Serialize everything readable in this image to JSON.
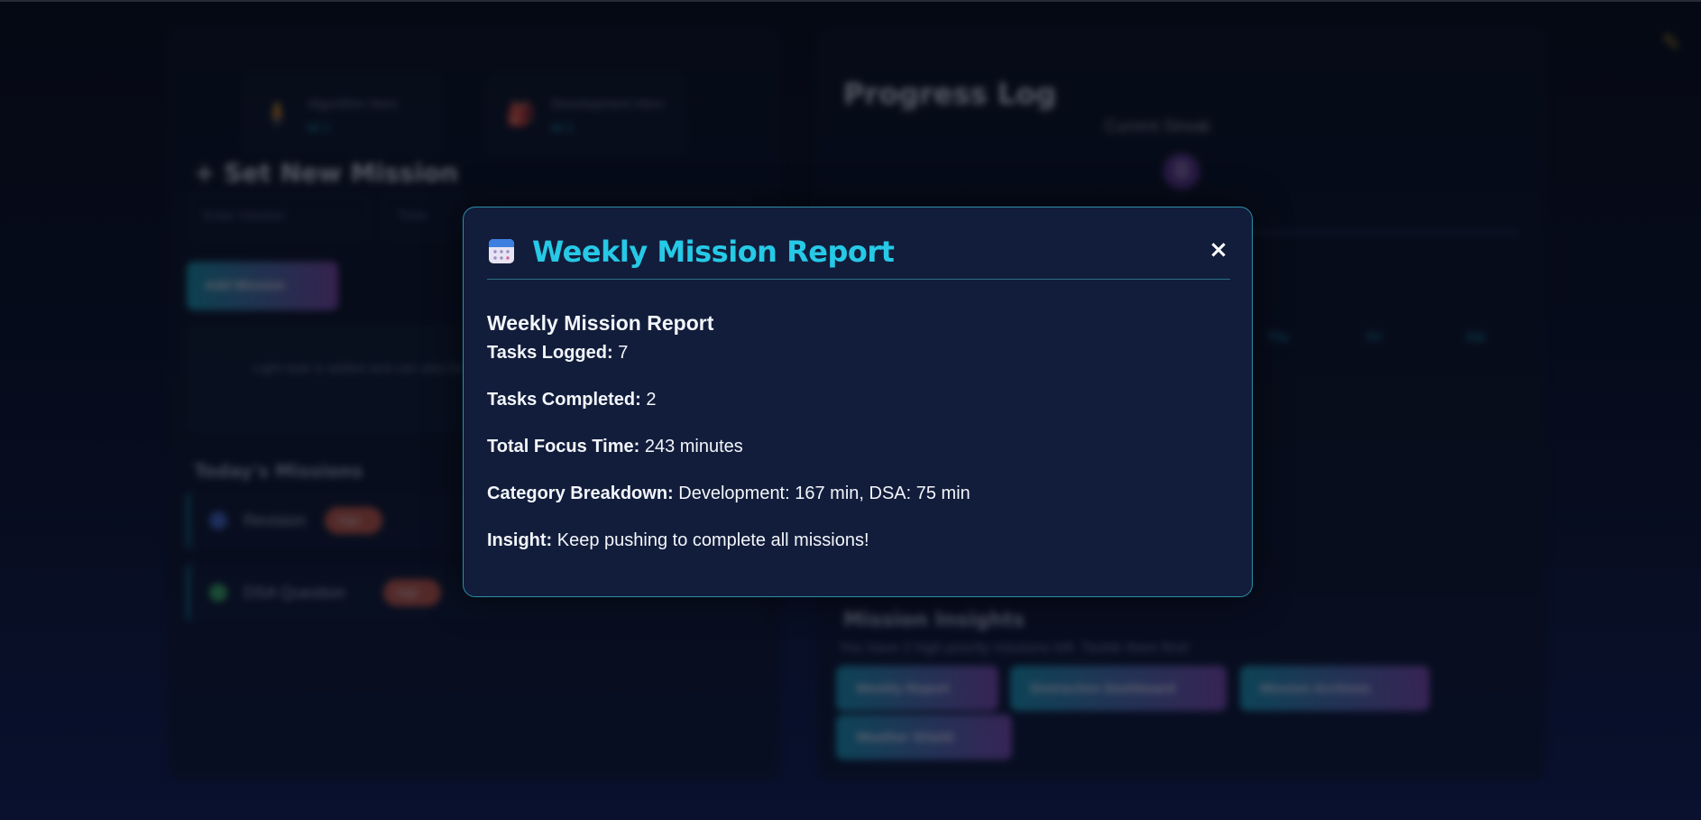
{
  "background": {
    "stats": [
      {
        "title": "Algorithm Hero",
        "value": "lvl 1",
        "icon": "hero-icon"
      },
      {
        "title": "Development Hero",
        "value": "lvl 1",
        "icon": "dev-icon"
      }
    ],
    "set_mission_title": "Set New Mission",
    "inputs": [
      "Enter mission",
      "Time",
      ""
    ],
    "add_button": "Add Mission",
    "hint": "Light task is added and can also be completed. Stay focused and on track.",
    "todays_missions_title": "Today's Missions",
    "tasks": [
      {
        "name": "Revision",
        "tag": "High",
        "dot_color": "#4a6fd1"
      },
      {
        "name": "DSA Question",
        "tag": "High",
        "dot_color": "#3fbf5f"
      }
    ],
    "progress_title": "Progress Log",
    "streak_label": "Current Streak",
    "streak_value": "0",
    "days": [
      "Thu",
      "Fri",
      "Sat"
    ],
    "insights_title": "Mission Insights",
    "insights_text": "You have 2 high-priority missions left. Tackle them first!",
    "buttons": [
      "Weekly Report",
      "Distraction Dashboard",
      "Mission Archives",
      "Weather Shield"
    ]
  },
  "modal": {
    "title": "Weekly Mission Report",
    "close_label": "×",
    "heading": "Weekly Mission Report",
    "lines": [
      {
        "label": "Tasks Logged:",
        "value": " 7"
      },
      {
        "label": "Tasks Completed:",
        "value": " 2"
      },
      {
        "label": "Total Focus Time:",
        "value": " 243 minutes"
      },
      {
        "label": "Category Breakdown:",
        "value": " Development: 167 min, DSA: 75 min"
      },
      {
        "label": "Insight:",
        "value": " Keep pushing to complete all missions!"
      }
    ]
  },
  "colors": {
    "accent": "#26c9e6",
    "modal_bg": "#121d3b",
    "modal_border": "#2a8fa8"
  }
}
